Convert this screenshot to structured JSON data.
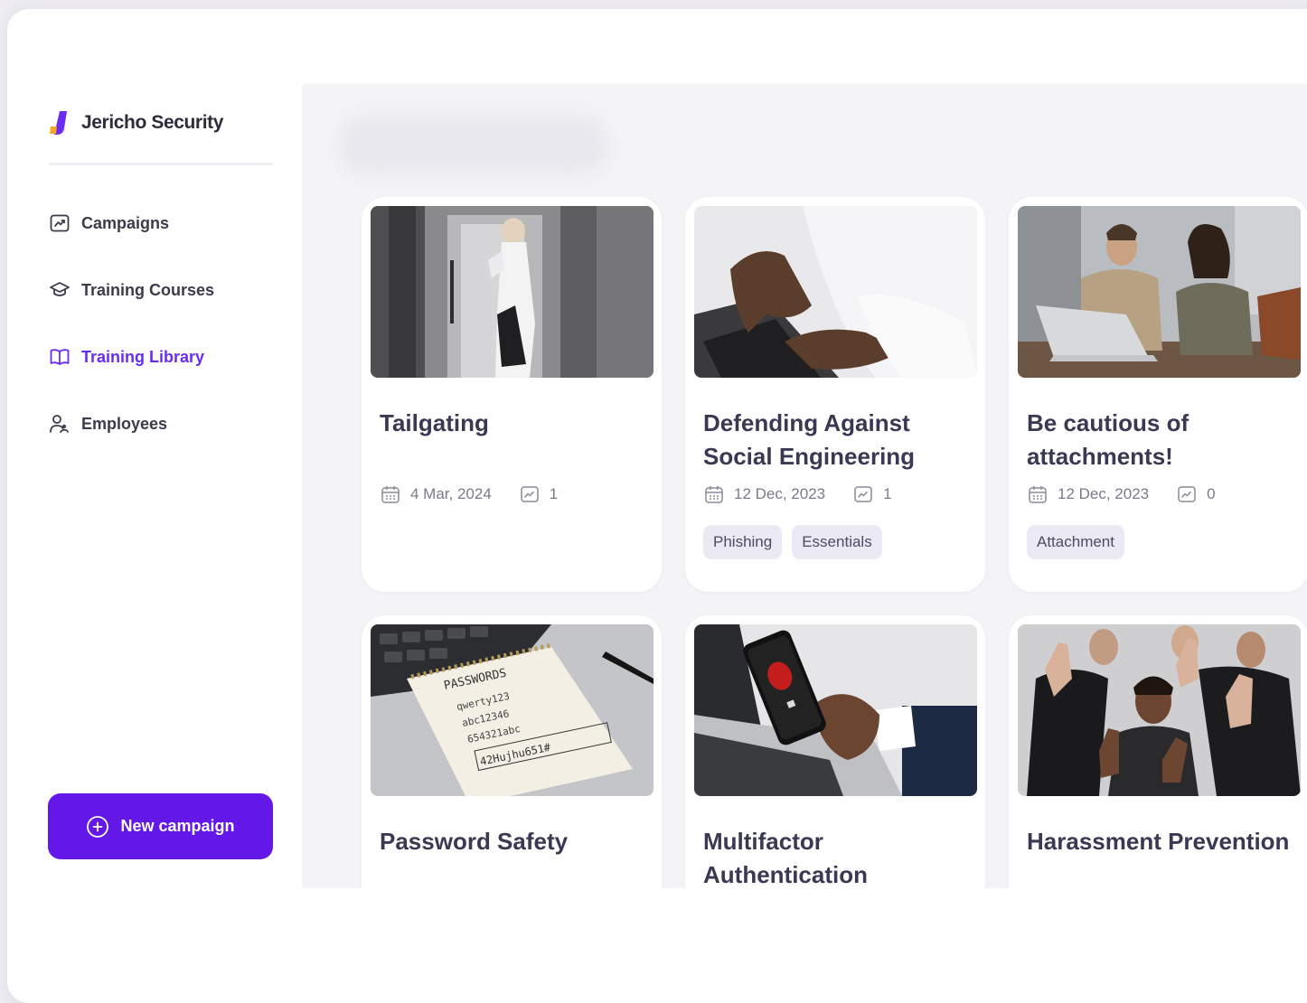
{
  "brand": {
    "name": "Jericho Security"
  },
  "colors": {
    "accent": "#6318e8",
    "active_nav": "#6a2cf0",
    "text": "#3a3954"
  },
  "nav": [
    {
      "label": "Campaigns",
      "icon": "trend-chart-icon",
      "active": false
    },
    {
      "label": "Training Courses",
      "icon": "graduation-cap-icon",
      "active": false
    },
    {
      "label": "Training Library",
      "icon": "book-icon",
      "active": true
    },
    {
      "label": "Employees",
      "icon": "users-icon",
      "active": false
    }
  ],
  "new_campaign": {
    "label": "New campaign",
    "icon": "plus-circle-icon"
  },
  "cards": [
    {
      "title": "Tailgating",
      "date": "4 Mar, 2024",
      "count": "1",
      "tags": []
    },
    {
      "title": "Defending Against Social Engineering",
      "date": "12 Dec, 2023",
      "count": "1",
      "tags": [
        "Phishing",
        "Essentials"
      ]
    },
    {
      "title": "Be cautious of attachments!",
      "date": "12 Dec, 2023",
      "count": "0",
      "tags": [
        "Attachment"
      ]
    },
    {
      "title": "Password Safety"
    },
    {
      "title": "Multifactor Authentication"
    },
    {
      "title": "Harassment Prevention"
    }
  ],
  "images": {
    "tailgating": "person-entering-door-photo",
    "social_engineering": "hands-typing-laptop-photo",
    "attachments": "colleagues-at-laptop-photo",
    "password": "notepad-passwords-photo",
    "mfa": "phone-fingerprint-photo",
    "harassment": "people-hands-raised-photo"
  },
  "notepad": {
    "heading": "PASSWORDS",
    "lines": [
      "qwerty123",
      "abc12346",
      "654321abc",
      "42Hujhu651#"
    ]
  }
}
